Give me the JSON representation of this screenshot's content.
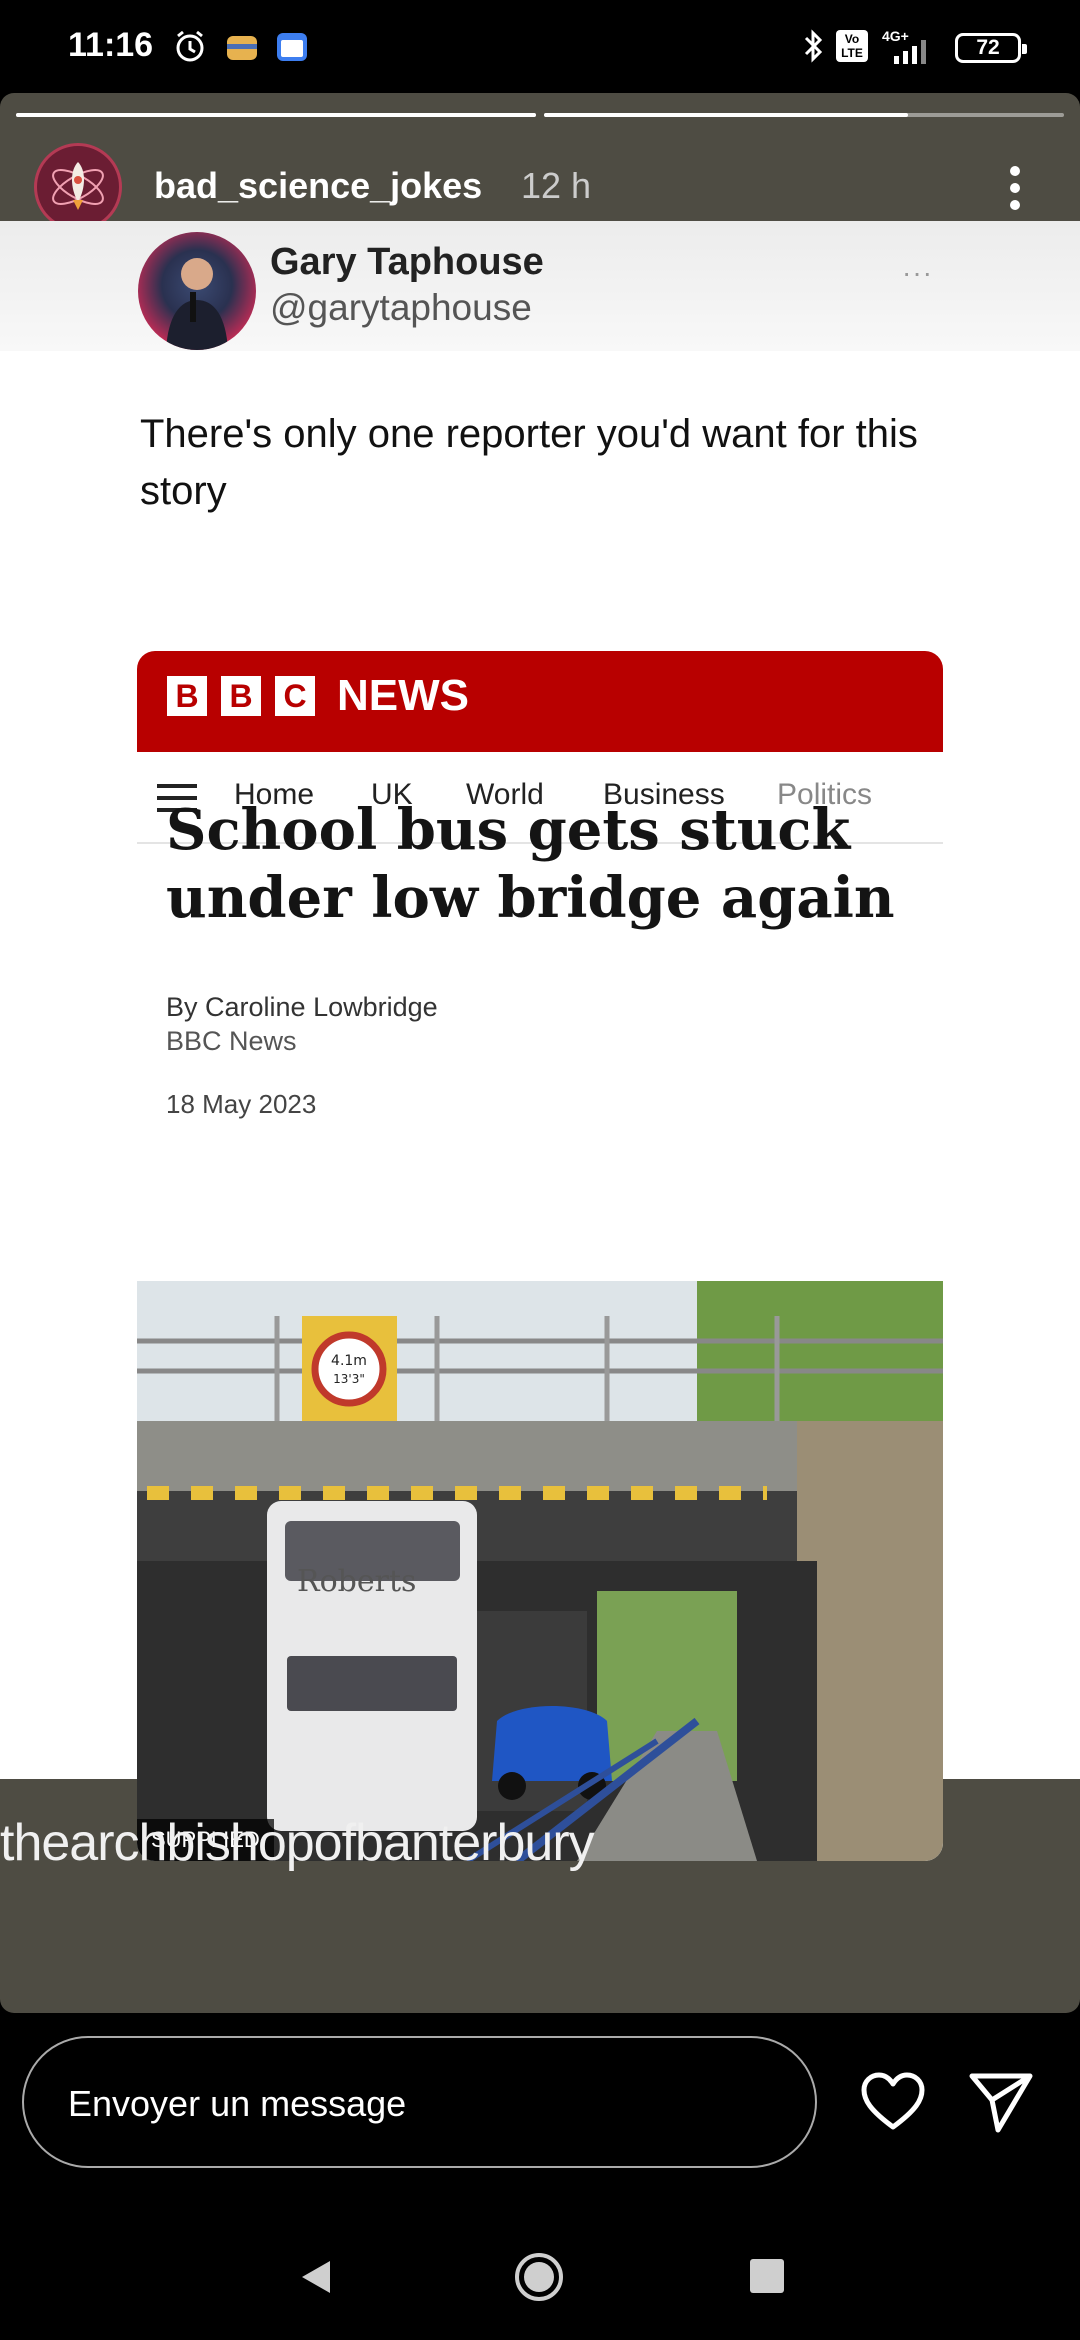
{
  "status_bar": {
    "time": "11:16",
    "battery": "72",
    "network": "4G+",
    "volte": "Vo LTE",
    "icons": [
      "alarm-icon",
      "app-notification-icon",
      "calendar-icon",
      "bluetooth-icon",
      "volte-icon",
      "signal-icon",
      "battery-icon"
    ]
  },
  "story": {
    "username": "bad_science_jokes",
    "age": "12 h",
    "progress": [
      1.0,
      0.7
    ],
    "caption": "thearchbishopofbanterbury"
  },
  "tweet": {
    "name": "Gary Taphouse",
    "handle": "@garytaphouse",
    "more": "···",
    "text": "There's only one reporter you'd want for this story"
  },
  "bbc": {
    "logo_letters": [
      "B",
      "B",
      "C"
    ],
    "brand": "NEWS",
    "nav": [
      "Home",
      "UK",
      "World",
      "Business",
      "Politics"
    ],
    "headline": "School bus gets stuck under low bridge again",
    "byline": "By Caroline Lowbridge",
    "source": "BBC News",
    "date": "18 May 2023",
    "image_label": "SUPPLIED",
    "sign_text_1": "4.1m",
    "sign_text_2": "13'3\"",
    "bus_brand": "Roberts"
  },
  "footer": {
    "message_placeholder": "Envoyer un message"
  },
  "colors": {
    "bbc_red": "#b80000",
    "story_bg": "#4e4c43"
  }
}
